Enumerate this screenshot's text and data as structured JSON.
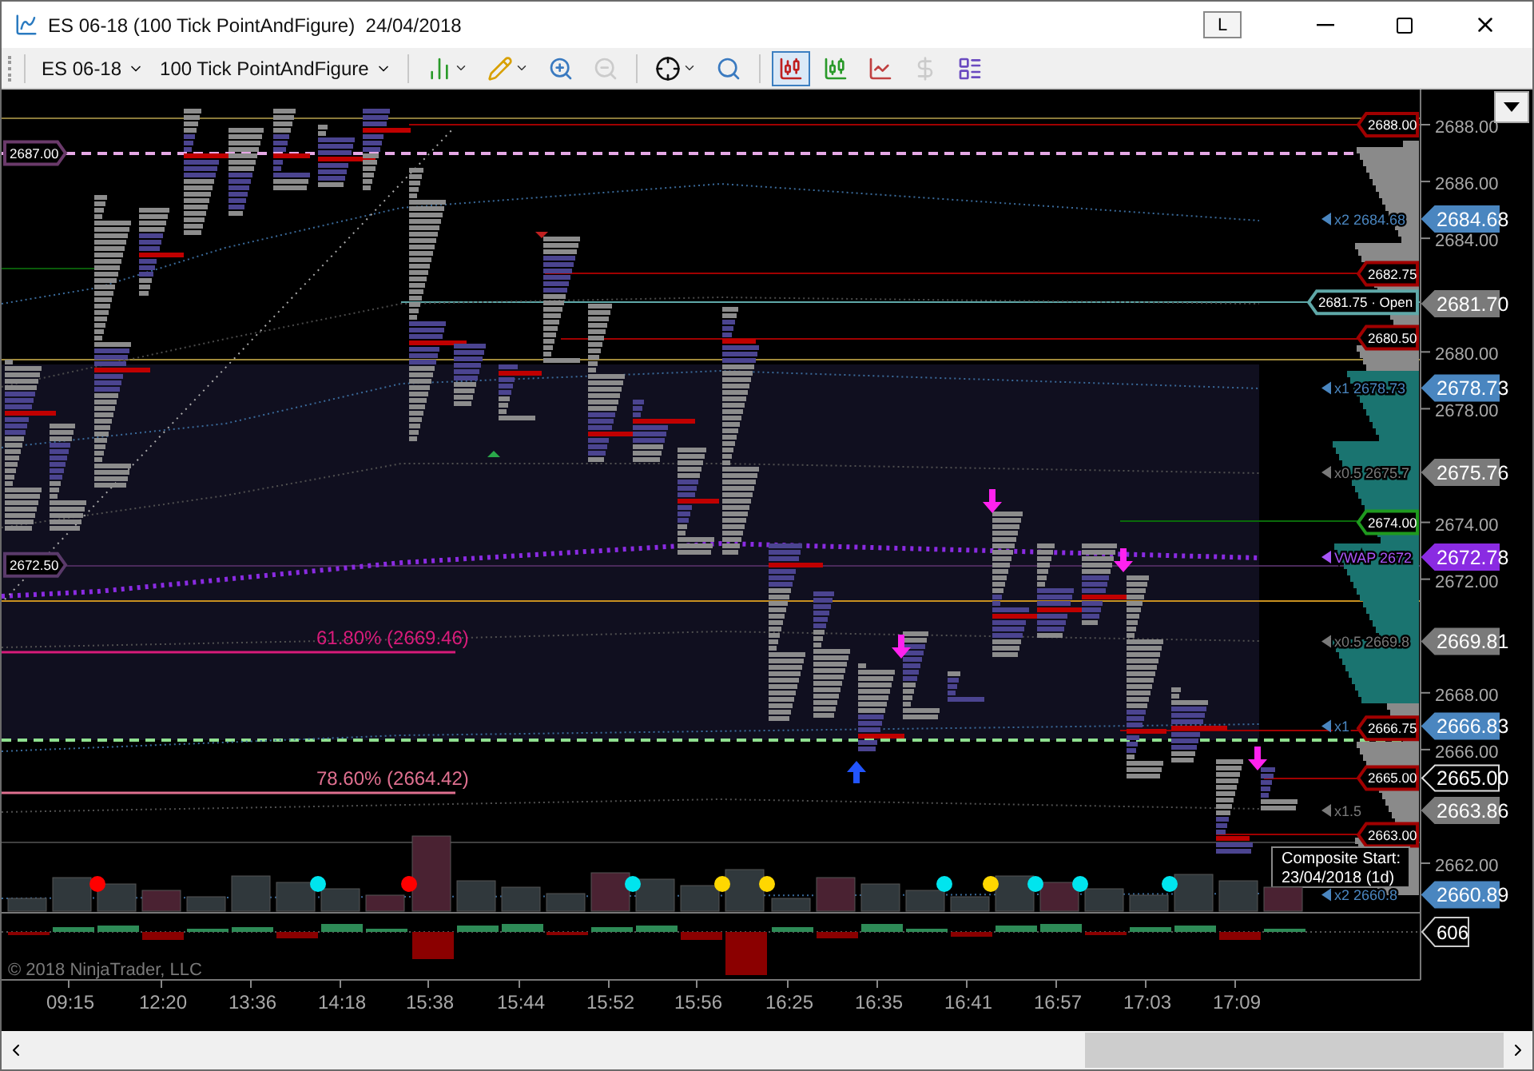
{
  "window": {
    "title": "ES 06-18 (100 Tick PointAndFigure)  24/04/2018",
    "link_button": "L"
  },
  "toolbar": {
    "instrument": "ES 06-18",
    "bar_type": "100 Tick PointAndFigure",
    "tools": [
      {
        "selected": false,
        "disabled": false
      },
      {
        "selected": false,
        "disabled": false
      },
      {
        "selected": false,
        "disabled": false
      },
      {
        "selected": false,
        "disabled": true
      },
      {
        "selected": false,
        "disabled": false
      },
      {
        "selected": false,
        "disabled": false
      },
      {
        "selected": true,
        "disabled": false
      },
      {
        "selected": false,
        "disabled": false
      },
      {
        "selected": false,
        "disabled": false
      },
      {
        "selected": false,
        "disabled": true
      },
      {
        "selected": false,
        "disabled": false
      }
    ]
  },
  "chart": {
    "price_ticks": [
      "2688.00",
      "2686.00",
      "2684.00",
      "2680.00",
      "2678.00",
      "2674.00",
      "2672.00",
      "2668.00",
      "2666.00",
      "2662.00"
    ],
    "axis_markers": [
      {
        "label": "2684.68",
        "kind": "filled",
        "color": "#4a86c0"
      },
      {
        "label": "2681.70",
        "kind": "filled",
        "color": "#7a7a7a"
      },
      {
        "label": "2678.73",
        "kind": "filled",
        "color": "#4a86c0"
      },
      {
        "label": "2675.76",
        "kind": "filled",
        "color": "#7a7a7a"
      },
      {
        "label": "2672.78",
        "kind": "filled",
        "color": "#8a2be2"
      },
      {
        "label": "2669.81",
        "kind": "filled",
        "color": "#7a7a7a"
      },
      {
        "label": "2666.83",
        "kind": "filled",
        "color": "#4a86c0"
      },
      {
        "label": "2665.00",
        "kind": "outlined",
        "color": "#e0e0e0"
      },
      {
        "label": "2663.86",
        "kind": "filled",
        "color": "#7a7a7a"
      },
      {
        "label": "2660.89",
        "kind": "filled",
        "color": "#4a86c0"
      }
    ],
    "line_labels": [
      {
        "label": "2688.00",
        "color": "#a00000"
      },
      {
        "label": "2682.75",
        "color": "#a00000"
      },
      {
        "label": "2681.75 · Open",
        "color": "#5fa8a8"
      },
      {
        "label": "2680.50",
        "color": "#a00000"
      },
      {
        "label": "2674.00",
        "color": "#1f9a1f"
      },
      {
        "label": "2666.75",
        "color": "#a00000"
      },
      {
        "label": "2665.00",
        "color": "#a00000"
      },
      {
        "label": "2663.00",
        "color": "#a00000"
      },
      {
        "label": "2687.00",
        "color": "#6a3a6a"
      },
      {
        "label": "2672.50",
        "color": "#5a3a6a"
      }
    ],
    "band_labels": [
      {
        "tag": "x2",
        "value": "2684.68",
        "color": "#4a86c0"
      },
      {
        "tag": "x1",
        "value": "2678.73",
        "color": "#4a86c0"
      },
      {
        "tag": "x0.5",
        "value": "2675.7",
        "color": "#7a7a7a"
      },
      {
        "tag": "VWAP",
        "value": "2672",
        "color": "#a855f7"
      },
      {
        "tag": "x0.5",
        "value": "2669.8",
        "color": "#7a7a7a"
      },
      {
        "tag": "x1",
        "color": "#4a86c0"
      },
      {
        "tag": "x1.5",
        "color": "#7a7a7a"
      },
      {
        "tag": "x2",
        "value": "2660.8",
        "color": "#4a86c0"
      }
    ],
    "fib_levels": [
      {
        "label": "61.80% (2669.46)",
        "color": "#d81b7a"
      },
      {
        "label": "78.60% (2664.42)",
        "color": "#e07090"
      }
    ],
    "tooltip": {
      "title": "Composite Start:",
      "text": "23/04/2018 (1d)"
    },
    "indicator_dots": [
      {
        "color": "#ff0000"
      },
      {
        "color": "#00e5ee"
      },
      {
        "color": "#ff0000"
      },
      {
        "color": "#00e5ee"
      },
      {
        "color": "#ffd700"
      },
      {
        "color": "#ffd700"
      },
      {
        "color": "#00e5ee"
      },
      {
        "color": "#ffd700"
      },
      {
        "color": "#00e5ee"
      },
      {
        "color": "#00e5ee"
      },
      {
        "color": "#00e5ee"
      }
    ],
    "oscillator_marker": "606",
    "copyright": "© 2018 NinjaTrader, LLC",
    "time_labels": [
      "09:15",
      "12:20",
      "13:36",
      "14:18",
      "15:38",
      "15:44",
      "15:52",
      "15:56",
      "16:25",
      "16:35",
      "16:41",
      "16:57",
      "17:03",
      "17:09"
    ]
  }
}
